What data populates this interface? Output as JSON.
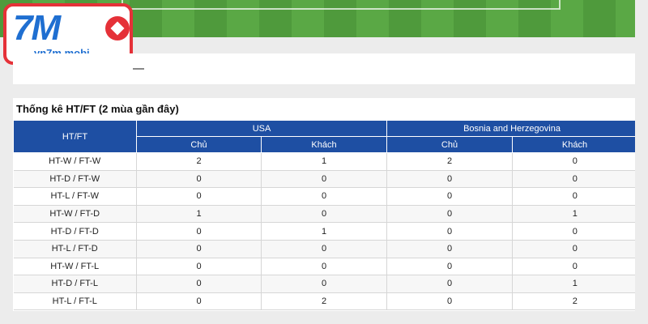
{
  "logo": {
    "main_text": "7M",
    "domain": "vn7m.mobi",
    "ball_icon": "soccer-ball-icon"
  },
  "panel": {
    "title": "Thống kê HT/FT (2 mùa gần đây)"
  },
  "table": {
    "header": {
      "row_label": "HT/FT",
      "team1": "USA",
      "team2": "Bosnia and Herzegovina",
      "team1_home": "Chủ",
      "team1_away": "Khách",
      "team2_home": "Chủ",
      "team2_away": "Khách"
    },
    "rows": [
      {
        "label": "HT-W / FT-W",
        "t1_home": "2",
        "t1_away": "1",
        "t2_home": "2",
        "t2_away": "0"
      },
      {
        "label": "HT-D / FT-W",
        "t1_home": "0",
        "t1_away": "0",
        "t2_home": "0",
        "t2_away": "0"
      },
      {
        "label": "HT-L / FT-W",
        "t1_home": "0",
        "t1_away": "0",
        "t2_home": "0",
        "t2_away": "0"
      },
      {
        "label": "HT-W / FT-D",
        "t1_home": "1",
        "t1_away": "0",
        "t2_home": "0",
        "t2_away": "1"
      },
      {
        "label": "HT-D / FT-D",
        "t1_home": "0",
        "t1_away": "1",
        "t2_home": "0",
        "t2_away": "0"
      },
      {
        "label": "HT-L / FT-D",
        "t1_home": "0",
        "t1_away": "0",
        "t2_home": "0",
        "t2_away": "0"
      },
      {
        "label": "HT-W / FT-L",
        "t1_home": "0",
        "t1_away": "0",
        "t2_home": "0",
        "t2_away": "0"
      },
      {
        "label": "HT-D / FT-L",
        "t1_home": "0",
        "t1_away": "0",
        "t2_home": "0",
        "t2_away": "1"
      },
      {
        "label": "HT-L / FT-L",
        "t1_home": "0",
        "t1_away": "2",
        "t2_home": "0",
        "t2_away": "2"
      }
    ]
  },
  "colors": {
    "header_blue": "#1e4fa3",
    "logo_red": "#e53138",
    "logo_blue": "#1f6fd1"
  }
}
